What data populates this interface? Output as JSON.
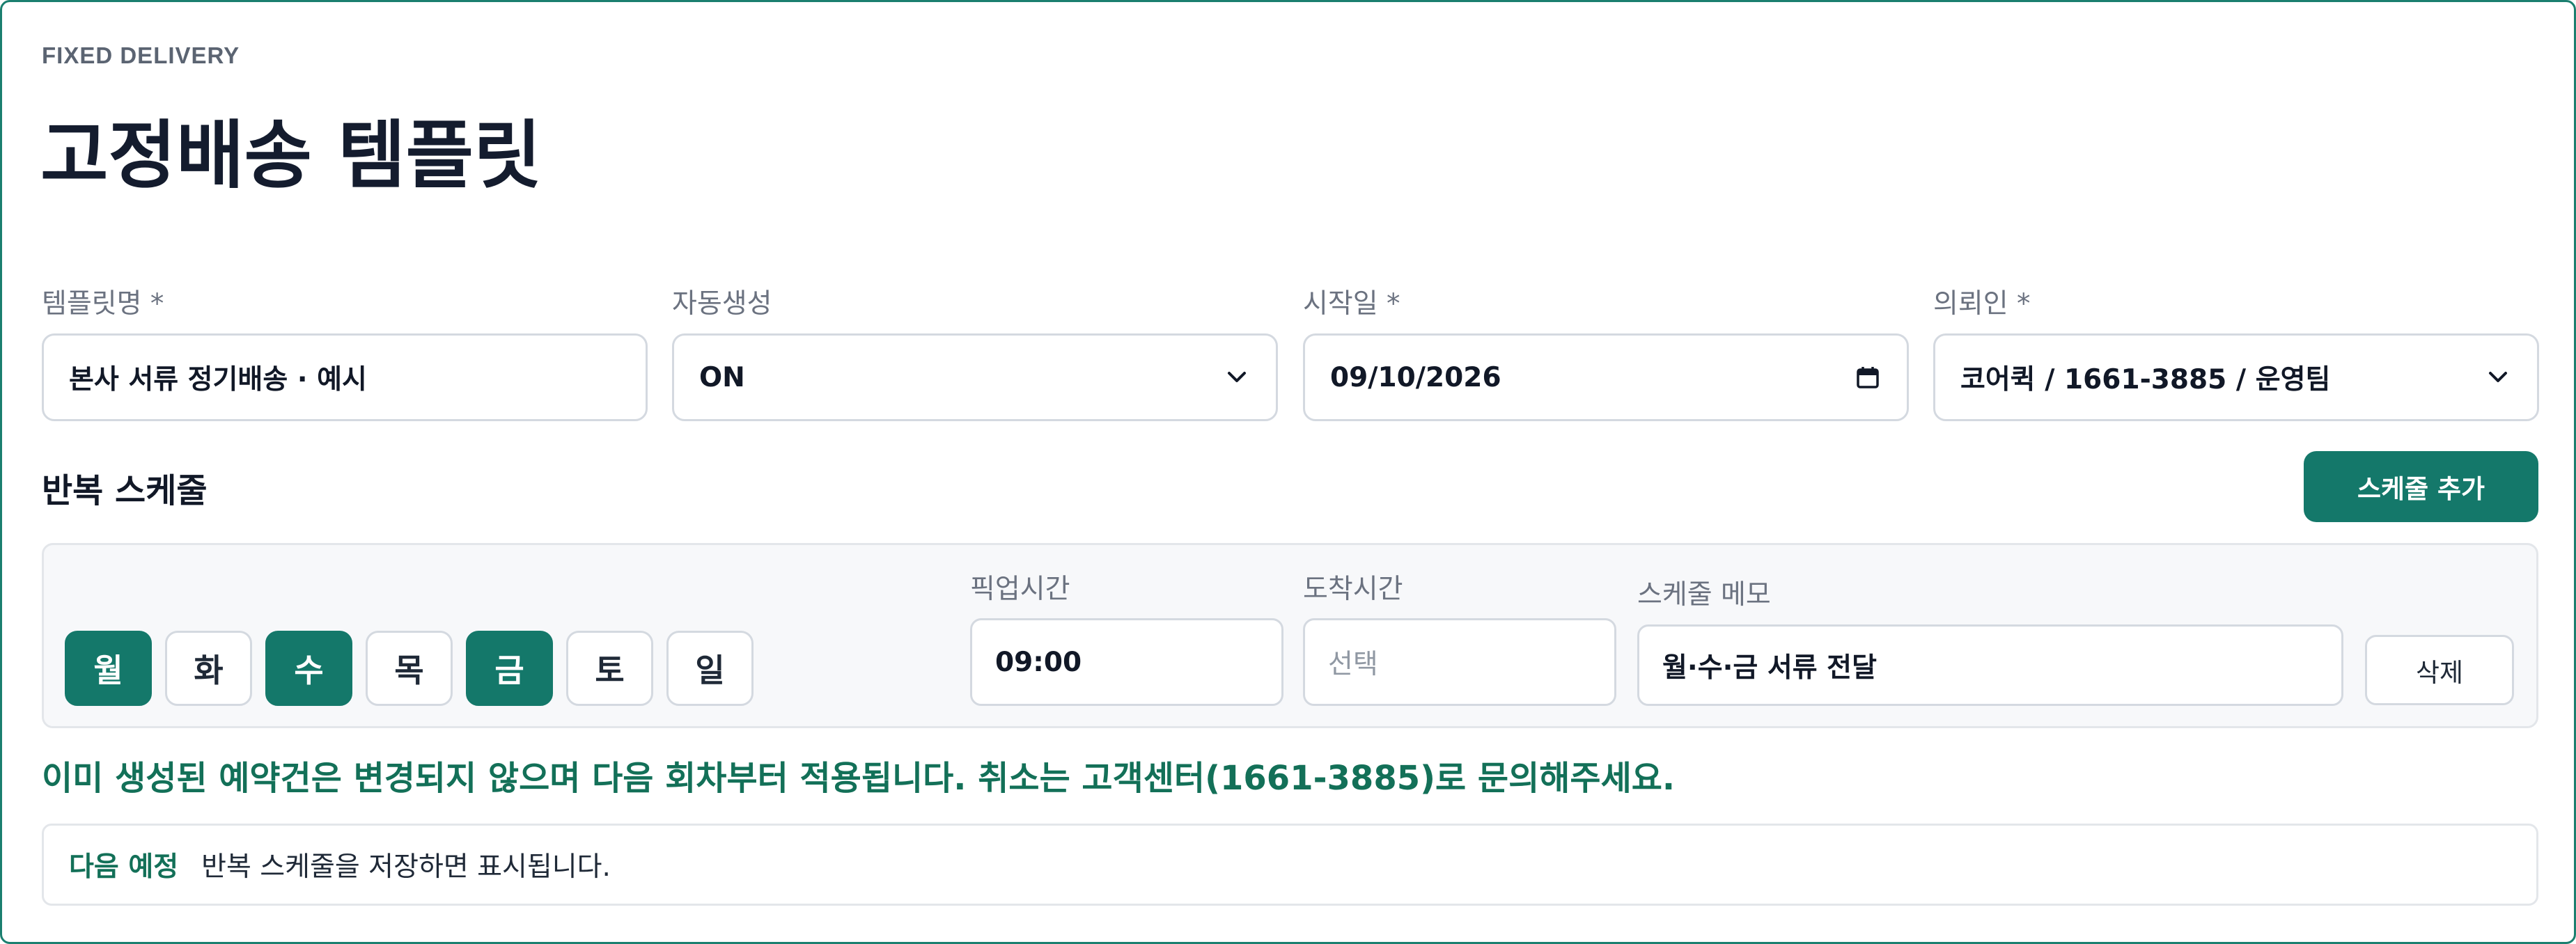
{
  "header": {
    "eyebrow": "FIXED DELIVERY",
    "title": "고정배송 템플릿"
  },
  "fields": {
    "template_name": {
      "label": "템플릿명 *",
      "value": "본사 서류 정기배송 · 예시"
    },
    "auto_create": {
      "label": "자동생성",
      "value": "ON",
      "icon": "chevron-down-icon"
    },
    "start_date": {
      "label": "시작일 *",
      "value": "09/10/2026",
      "icon": "calendar-icon"
    },
    "client": {
      "label": "의뢰인 *",
      "value": "코어퀵 / 1661-3885 / 운영팀",
      "icon": "chevron-down-icon"
    }
  },
  "schedule": {
    "section_title": "반복 스케줄",
    "add_button": "스케줄 추가",
    "days": [
      {
        "label": "월",
        "selected": true
      },
      {
        "label": "화",
        "selected": false
      },
      {
        "label": "수",
        "selected": true
      },
      {
        "label": "목",
        "selected": false
      },
      {
        "label": "금",
        "selected": true
      },
      {
        "label": "토",
        "selected": false
      },
      {
        "label": "일",
        "selected": false
      }
    ],
    "pickup": {
      "label": "픽업시간",
      "value": "09:00"
    },
    "arrival": {
      "label": "도착시간",
      "placeholder": "선택"
    },
    "memo": {
      "label": "스케줄 메모",
      "value": "월·수·금 서류 전달"
    },
    "delete_button": "삭제"
  },
  "notice": "이미 생성된 예약건은 변경되지 않으며 다음 회차부터 적용됩니다. 취소는 고객센터(1661-3885)로 문의해주세요.",
  "next": {
    "label": "다음 예정",
    "text": "반복 스케줄을 저장하면 표시됩니다."
  },
  "colors": {
    "accent": "#14786a",
    "notice": "#137058",
    "border": "#1b7f6f"
  }
}
